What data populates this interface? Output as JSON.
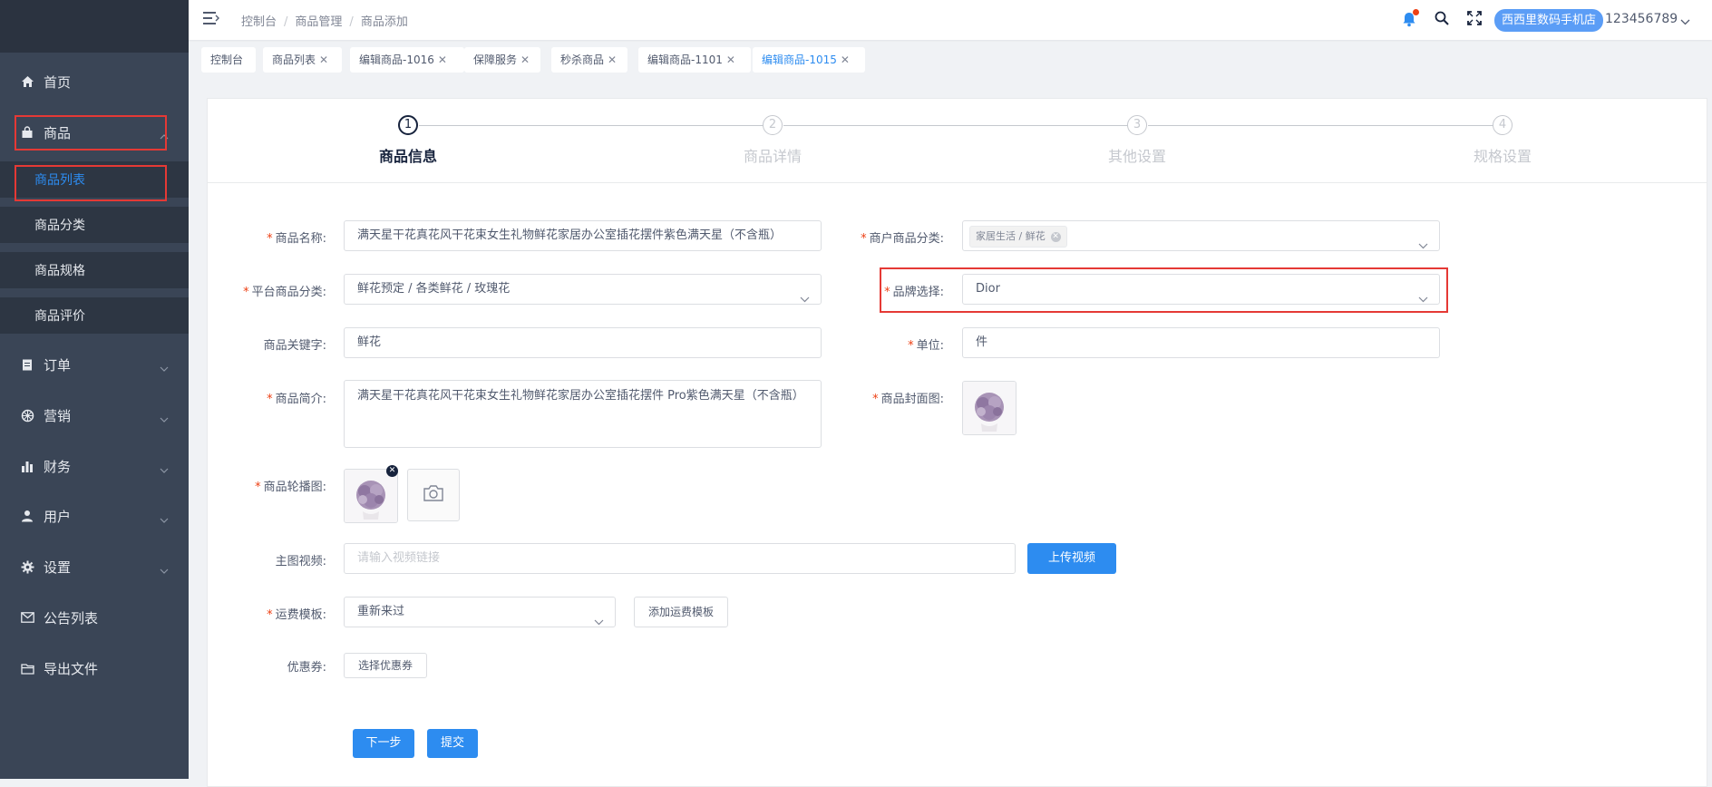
{
  "sidebar": {
    "items": [
      {
        "label": "首页",
        "icon": "home-icon"
      },
      {
        "label": "商品",
        "icon": "bag-icon"
      },
      {
        "label": "订单",
        "icon": "clipboard-icon"
      },
      {
        "label": "营销",
        "icon": "wheel-icon"
      },
      {
        "label": "财务",
        "icon": "bar-chart-icon"
      },
      {
        "label": "用户",
        "icon": "user-icon"
      },
      {
        "label": "设置",
        "icon": "gear-icon"
      },
      {
        "label": "公告列表",
        "icon": "mail-icon"
      },
      {
        "label": "导出文件",
        "icon": "folder-icon"
      }
    ],
    "submenu": [
      {
        "label": "商品列表",
        "active": true
      },
      {
        "label": "商品分类"
      },
      {
        "label": "商品规格"
      },
      {
        "label": "商品评价"
      }
    ]
  },
  "header": {
    "breadcrumb": [
      "控制台",
      "商品管理",
      "商品添加"
    ],
    "store_name": "西西里数码手机店",
    "username": "123456789"
  },
  "tabs": [
    {
      "label": "控制台",
      "closable": false
    },
    {
      "label": "商品列表",
      "closable": true
    },
    {
      "label": "编辑商品-1016",
      "closable": true
    },
    {
      "label": "保障服务",
      "closable": true
    },
    {
      "label": "秒杀商品",
      "closable": true
    },
    {
      "label": "编辑商品-1101",
      "closable": true
    },
    {
      "label": "编辑商品-1015",
      "closable": true,
      "active": true
    }
  ],
  "steps": [
    {
      "num": "1",
      "label": "商品信息",
      "active": true
    },
    {
      "num": "2",
      "label": "商品详情"
    },
    {
      "num": "3",
      "label": "其他设置"
    },
    {
      "num": "4",
      "label": "规格设置"
    }
  ],
  "form": {
    "name": {
      "label": "商品名称:",
      "value": "满天星干花真花风干花束女生礼物鲜花家居办公室插花摆件紫色满天星（不含瓶）"
    },
    "merchant_category": {
      "label": "商户商品分类:",
      "tag": "家居生活 / 鲜花"
    },
    "platform_category": {
      "label": "平台商品分类:",
      "value": "鲜花预定 / 各类鲜花 / 玫瑰花"
    },
    "brand": {
      "label": "品牌选择:",
      "value": "Dior"
    },
    "keywords": {
      "label": "商品关键字:",
      "value": "鲜花"
    },
    "unit": {
      "label": "单位:",
      "value": "件"
    },
    "intro": {
      "label": "商品简介:",
      "value": "满天星干花真花风干花束女生礼物鲜花家居办公室插花摆件 Pro紫色满天星（不含瓶）"
    },
    "cover": {
      "label": "商品封面图:"
    },
    "carousel": {
      "label": "商品轮播图:"
    },
    "video": {
      "label": "主图视频:",
      "placeholder": "请输入视频链接",
      "button": "上传视频"
    },
    "shipping": {
      "label": "运费模板:",
      "value": "重新来过",
      "add_button": "添加运费模板"
    },
    "coupon": {
      "label": "优惠券:",
      "button": "选择优惠券"
    }
  },
  "actions": {
    "next": "下一步",
    "submit": "提交"
  },
  "colors": {
    "primary": "#2d8cf0",
    "sidebar_bg": "#3a4556",
    "highlight_border": "#e53935",
    "required": "#ed4014"
  }
}
